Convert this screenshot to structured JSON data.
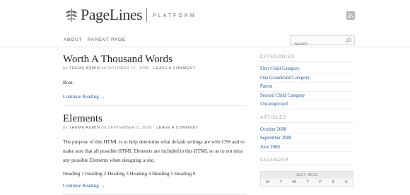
{
  "header": {
    "logo_text": "PageLines",
    "tagline": "PLATFORM"
  },
  "nav": {
    "items": [
      {
        "label": "ABOUT"
      },
      {
        "label": "PARENT PAGE"
      }
    ]
  },
  "search": {
    "placeholder": "Search"
  },
  "posts": [
    {
      "title": "Worth A Thousand Words",
      "by": "by",
      "author": "THEME ADMIN",
      "on": "on",
      "date": "OCTOBER 17, 2008",
      "comment": "LEAVE A COMMENT",
      "body": "Boat.",
      "continue": "Continue Reading →"
    },
    {
      "title": "Elements",
      "by": "by",
      "author": "THEME ADMIN",
      "on": "on",
      "date": "SEPTEMBER 5, 2008",
      "comment": "LEAVE A COMMENT",
      "body": "The purpose of this HTML is to help determine what default settings are with CSS and to make sure that all possible HTML Elements are included in this HTML so as to not miss any possible Elements when designing a site.",
      "headings": "Heading 1 Heading 2 Heading 3 Heading 4 Heading 5 Heading 6",
      "continue": "Continue Reading →"
    }
  ],
  "sidebar": {
    "categories_title": "CATEGORIES",
    "categories": [
      "First Child Category",
      "One Grandchild Category",
      "Parent",
      "Second Child Category",
      "Uncategorized"
    ],
    "articles_title": "ARTICLES",
    "articles": [
      "October 2008",
      "September 2008",
      "June 2008"
    ],
    "calendar_title": "CALENDAR",
    "calendar_caption": "JULY 2012",
    "calendar_days": [
      "M",
      "T",
      "W",
      "T",
      "F",
      "S",
      "S"
    ]
  },
  "colors": {
    "link": "#2b5a93",
    "text": "#333333",
    "muted": "#888888"
  }
}
